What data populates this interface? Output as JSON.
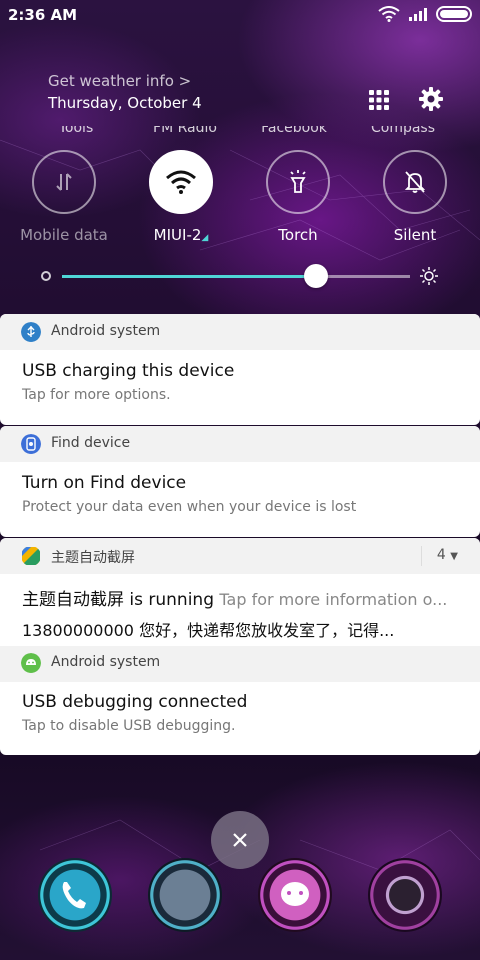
{
  "status_bar": {
    "time": "2:36 AM"
  },
  "header": {
    "weather_link": "Get weather info >",
    "date": "Thursday, October 4"
  },
  "cut_labels": [
    "Tools",
    "FM Radio",
    "Facebook",
    "Compass"
  ],
  "toggles": [
    {
      "label": "Mobile data",
      "icon": "mobile-data-icon",
      "on": false
    },
    {
      "label": "MIUI-2",
      "icon": "wifi-icon",
      "on": true
    },
    {
      "label": "Torch",
      "icon": "torch-icon",
      "on": false
    },
    {
      "label": "Silent",
      "icon": "silent-bell-icon",
      "on": false
    }
  ],
  "brightness": {
    "level": 0.73
  },
  "notifications": [
    {
      "app": "Android system",
      "title": "USB charging this device",
      "text": "Tap for more options."
    },
    {
      "app": "Find device",
      "title": "Turn on Find device",
      "text": "Protect your data even when your device is lost"
    },
    {
      "app": "主题自动截屏",
      "count": "4",
      "title": "主题自动截屏 is running",
      "title_extra": "Tap for more information o...",
      "text": "13800000000 您好，快递帮您放收发室了，记得..."
    },
    {
      "app": "Android system",
      "title": "USB debugging connected",
      "text": "Tap to disable USB debugging."
    }
  ],
  "colors": {
    "accent": "#4fd6d6",
    "panel_bg": "#1d0b2c"
  },
  "dock": [
    "phone-icon",
    "browser-icon",
    "messages-icon",
    "camera-icon"
  ]
}
